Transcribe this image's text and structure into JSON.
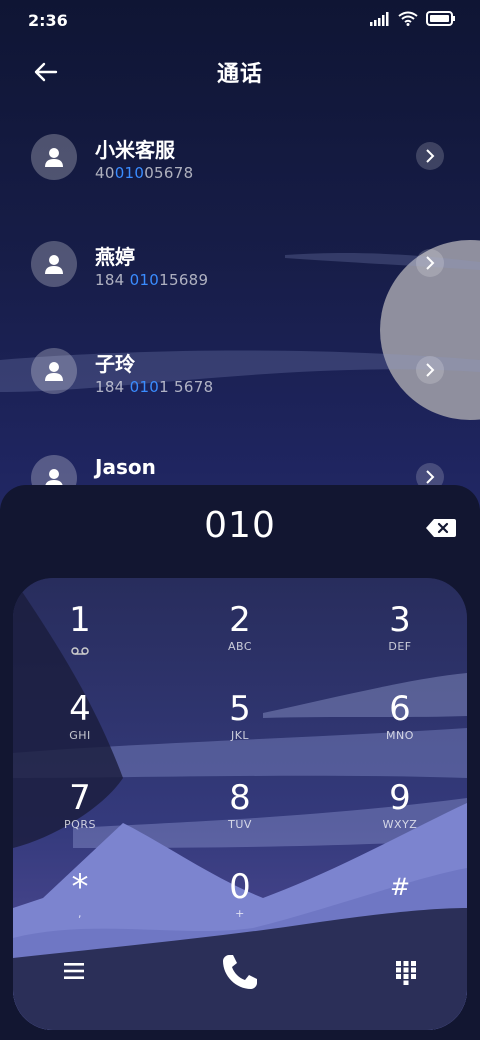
{
  "status": {
    "time": "2:36"
  },
  "header": {
    "title": "通话"
  },
  "contacts": [
    {
      "name": "小米客服",
      "number_pre": "40",
      "number_hl": "010",
      "number_post": "05678"
    },
    {
      "name": "燕婷",
      "number_pre": "184 ",
      "number_hl": "010",
      "number_post": "15689"
    },
    {
      "name": "子玲",
      "number_pre": "184 ",
      "number_hl": "010",
      "number_post": "1 5678"
    },
    {
      "name": "Jason",
      "number_pre": "",
      "number_hl": "",
      "number_post": ""
    }
  ],
  "dialer": {
    "entered": "010",
    "keys": [
      {
        "digit": "1",
        "letters": "voicemail"
      },
      {
        "digit": "2",
        "letters": "ABC"
      },
      {
        "digit": "3",
        "letters": "DEF"
      },
      {
        "digit": "4",
        "letters": "GHI"
      },
      {
        "digit": "5",
        "letters": "JKL"
      },
      {
        "digit": "6",
        "letters": "MNO"
      },
      {
        "digit": "7",
        "letters": "PQRS"
      },
      {
        "digit": "8",
        "letters": "TUV"
      },
      {
        "digit": "9",
        "letters": "WXYZ"
      },
      {
        "digit": "*",
        "letters": ","
      },
      {
        "digit": "0",
        "letters": "+"
      },
      {
        "digit": "#",
        "letters": ""
      }
    ]
  },
  "icons": {
    "menu": "menu-icon",
    "call": "phone-icon",
    "keypad": "keypad-icon",
    "backspace": "backspace-icon"
  },
  "colors": {
    "highlight": "#3a8cff",
    "sheet": "#121631"
  }
}
